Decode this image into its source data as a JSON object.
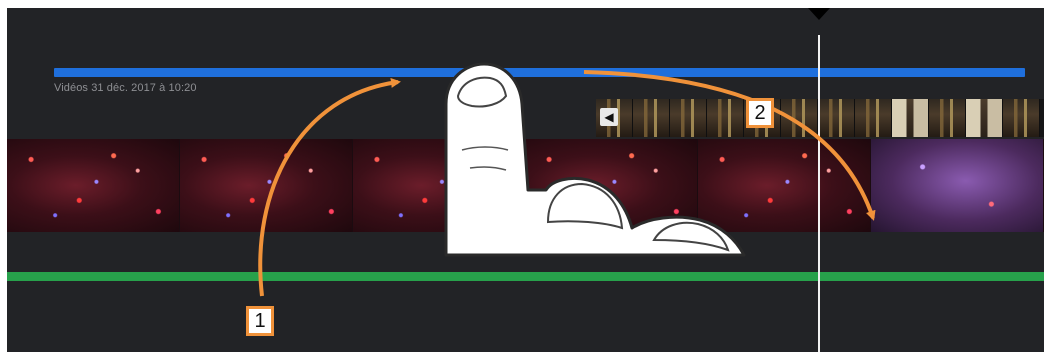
{
  "timeline": {
    "video_title": "Vidéos 31 déc. 2017 à 10:20",
    "audio_muted_icon": "speaker-muted-icon"
  },
  "annotations": {
    "step_1": "1",
    "step_2": "2",
    "arrow_color": "#f0923a"
  },
  "colors": {
    "background": "#222326",
    "selection_bar": "#1f6fdc",
    "audio_track": "#27a14b",
    "playhead": "#f2f2f2"
  },
  "icons": {
    "gesture": "tap-finger-icon",
    "playhead_marker": "playhead-triangle-icon"
  }
}
